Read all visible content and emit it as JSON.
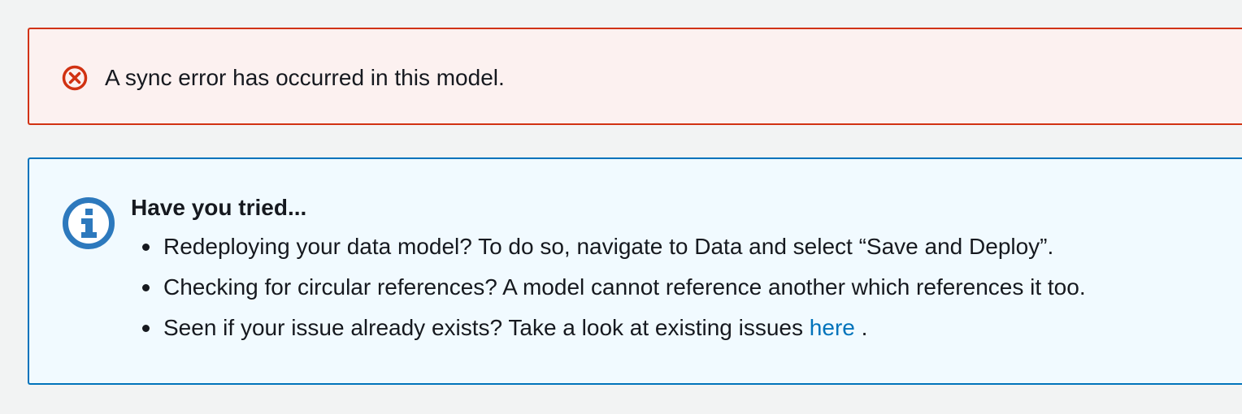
{
  "error_alert": {
    "icon": "error-circle-x-icon",
    "message": "A sync error has occurred in this model.",
    "color": "#d13212",
    "background": "#fcf1f0"
  },
  "info_alert": {
    "icon": "info-circle-icon",
    "title": "Have you tried...",
    "color": "#0073bb",
    "background": "#f1faff",
    "items": [
      {
        "text": "Redeploying your data model? To do so, navigate to Data and select “Save and Deploy”."
      },
      {
        "text": "Checking for circular references? A model cannot reference another which references it too."
      },
      {
        "text_before": "Seen if your issue already exists? Take a look at existing issues ",
        "link": "here",
        "text_after": " ."
      }
    ]
  }
}
